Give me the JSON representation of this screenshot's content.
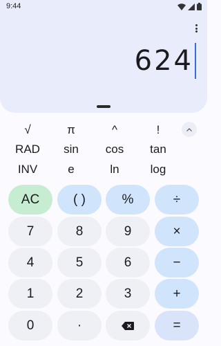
{
  "status_bar": {
    "time": "9:44",
    "icons": [
      "wifi-icon",
      "signal-icon",
      "battery-icon"
    ]
  },
  "display": {
    "expression": "624"
  },
  "scientific": {
    "row1": [
      "√",
      "π",
      "^",
      "!"
    ],
    "row2": [
      "RAD",
      "sin",
      "cos",
      "tan"
    ],
    "row3": [
      "INV",
      "e",
      "ln",
      "log"
    ]
  },
  "keypad": {
    "ac": "AC",
    "paren": "( )",
    "percent": "%",
    "divide": "÷",
    "seven": "7",
    "eight": "8",
    "nine": "9",
    "multiply": "×",
    "four": "4",
    "five": "5",
    "six": "6",
    "minus": "−",
    "one": "1",
    "two": "2",
    "three": "3",
    "plus": "+",
    "zero": "0",
    "decimal": "·",
    "equals": "="
  },
  "colors": {
    "display_bg": "#e9ecfb",
    "operator_bg": "#d0e4fb",
    "ac_bg": "#c6ecd1",
    "digit_bg": "#eef0f6",
    "cursor": "#3a6ae0"
  }
}
